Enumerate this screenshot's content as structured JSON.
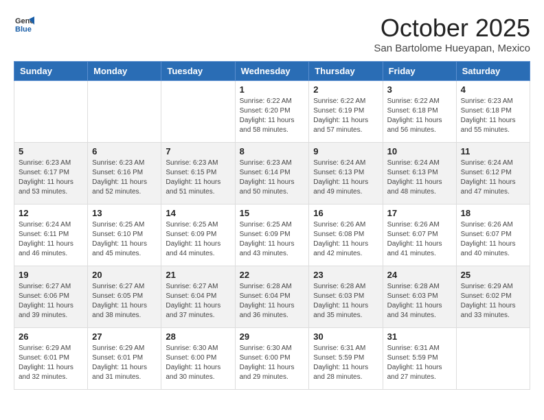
{
  "header": {
    "logo_general": "General",
    "logo_blue": "Blue",
    "month_title": "October 2025",
    "location": "San Bartolome Hueyapan, Mexico"
  },
  "weekdays": [
    "Sunday",
    "Monday",
    "Tuesday",
    "Wednesday",
    "Thursday",
    "Friday",
    "Saturday"
  ],
  "weeks": [
    [
      {
        "day": "",
        "info": ""
      },
      {
        "day": "",
        "info": ""
      },
      {
        "day": "",
        "info": ""
      },
      {
        "day": "1",
        "info": "Sunrise: 6:22 AM\nSunset: 6:20 PM\nDaylight: 11 hours and 58 minutes."
      },
      {
        "day": "2",
        "info": "Sunrise: 6:22 AM\nSunset: 6:19 PM\nDaylight: 11 hours and 57 minutes."
      },
      {
        "day": "3",
        "info": "Sunrise: 6:22 AM\nSunset: 6:18 PM\nDaylight: 11 hours and 56 minutes."
      },
      {
        "day": "4",
        "info": "Sunrise: 6:23 AM\nSunset: 6:18 PM\nDaylight: 11 hours and 55 minutes."
      }
    ],
    [
      {
        "day": "5",
        "info": "Sunrise: 6:23 AM\nSunset: 6:17 PM\nDaylight: 11 hours and 53 minutes."
      },
      {
        "day": "6",
        "info": "Sunrise: 6:23 AM\nSunset: 6:16 PM\nDaylight: 11 hours and 52 minutes."
      },
      {
        "day": "7",
        "info": "Sunrise: 6:23 AM\nSunset: 6:15 PM\nDaylight: 11 hours and 51 minutes."
      },
      {
        "day": "8",
        "info": "Sunrise: 6:23 AM\nSunset: 6:14 PM\nDaylight: 11 hours and 50 minutes."
      },
      {
        "day": "9",
        "info": "Sunrise: 6:24 AM\nSunset: 6:13 PM\nDaylight: 11 hours and 49 minutes."
      },
      {
        "day": "10",
        "info": "Sunrise: 6:24 AM\nSunset: 6:13 PM\nDaylight: 11 hours and 48 minutes."
      },
      {
        "day": "11",
        "info": "Sunrise: 6:24 AM\nSunset: 6:12 PM\nDaylight: 11 hours and 47 minutes."
      }
    ],
    [
      {
        "day": "12",
        "info": "Sunrise: 6:24 AM\nSunset: 6:11 PM\nDaylight: 11 hours and 46 minutes."
      },
      {
        "day": "13",
        "info": "Sunrise: 6:25 AM\nSunset: 6:10 PM\nDaylight: 11 hours and 45 minutes."
      },
      {
        "day": "14",
        "info": "Sunrise: 6:25 AM\nSunset: 6:09 PM\nDaylight: 11 hours and 44 minutes."
      },
      {
        "day": "15",
        "info": "Sunrise: 6:25 AM\nSunset: 6:09 PM\nDaylight: 11 hours and 43 minutes."
      },
      {
        "day": "16",
        "info": "Sunrise: 6:26 AM\nSunset: 6:08 PM\nDaylight: 11 hours and 42 minutes."
      },
      {
        "day": "17",
        "info": "Sunrise: 6:26 AM\nSunset: 6:07 PM\nDaylight: 11 hours and 41 minutes."
      },
      {
        "day": "18",
        "info": "Sunrise: 6:26 AM\nSunset: 6:07 PM\nDaylight: 11 hours and 40 minutes."
      }
    ],
    [
      {
        "day": "19",
        "info": "Sunrise: 6:27 AM\nSunset: 6:06 PM\nDaylight: 11 hours and 39 minutes."
      },
      {
        "day": "20",
        "info": "Sunrise: 6:27 AM\nSunset: 6:05 PM\nDaylight: 11 hours and 38 minutes."
      },
      {
        "day": "21",
        "info": "Sunrise: 6:27 AM\nSunset: 6:04 PM\nDaylight: 11 hours and 37 minutes."
      },
      {
        "day": "22",
        "info": "Sunrise: 6:28 AM\nSunset: 6:04 PM\nDaylight: 11 hours and 36 minutes."
      },
      {
        "day": "23",
        "info": "Sunrise: 6:28 AM\nSunset: 6:03 PM\nDaylight: 11 hours and 35 minutes."
      },
      {
        "day": "24",
        "info": "Sunrise: 6:28 AM\nSunset: 6:03 PM\nDaylight: 11 hours and 34 minutes."
      },
      {
        "day": "25",
        "info": "Sunrise: 6:29 AM\nSunset: 6:02 PM\nDaylight: 11 hours and 33 minutes."
      }
    ],
    [
      {
        "day": "26",
        "info": "Sunrise: 6:29 AM\nSunset: 6:01 PM\nDaylight: 11 hours and 32 minutes."
      },
      {
        "day": "27",
        "info": "Sunrise: 6:29 AM\nSunset: 6:01 PM\nDaylight: 11 hours and 31 minutes."
      },
      {
        "day": "28",
        "info": "Sunrise: 6:30 AM\nSunset: 6:00 PM\nDaylight: 11 hours and 30 minutes."
      },
      {
        "day": "29",
        "info": "Sunrise: 6:30 AM\nSunset: 6:00 PM\nDaylight: 11 hours and 29 minutes."
      },
      {
        "day": "30",
        "info": "Sunrise: 6:31 AM\nSunset: 5:59 PM\nDaylight: 11 hours and 28 minutes."
      },
      {
        "day": "31",
        "info": "Sunrise: 6:31 AM\nSunset: 5:59 PM\nDaylight: 11 hours and 27 minutes."
      },
      {
        "day": "",
        "info": ""
      }
    ]
  ],
  "row_classes": [
    "row-white",
    "row-alt",
    "row-white",
    "row-alt",
    "row-white"
  ]
}
